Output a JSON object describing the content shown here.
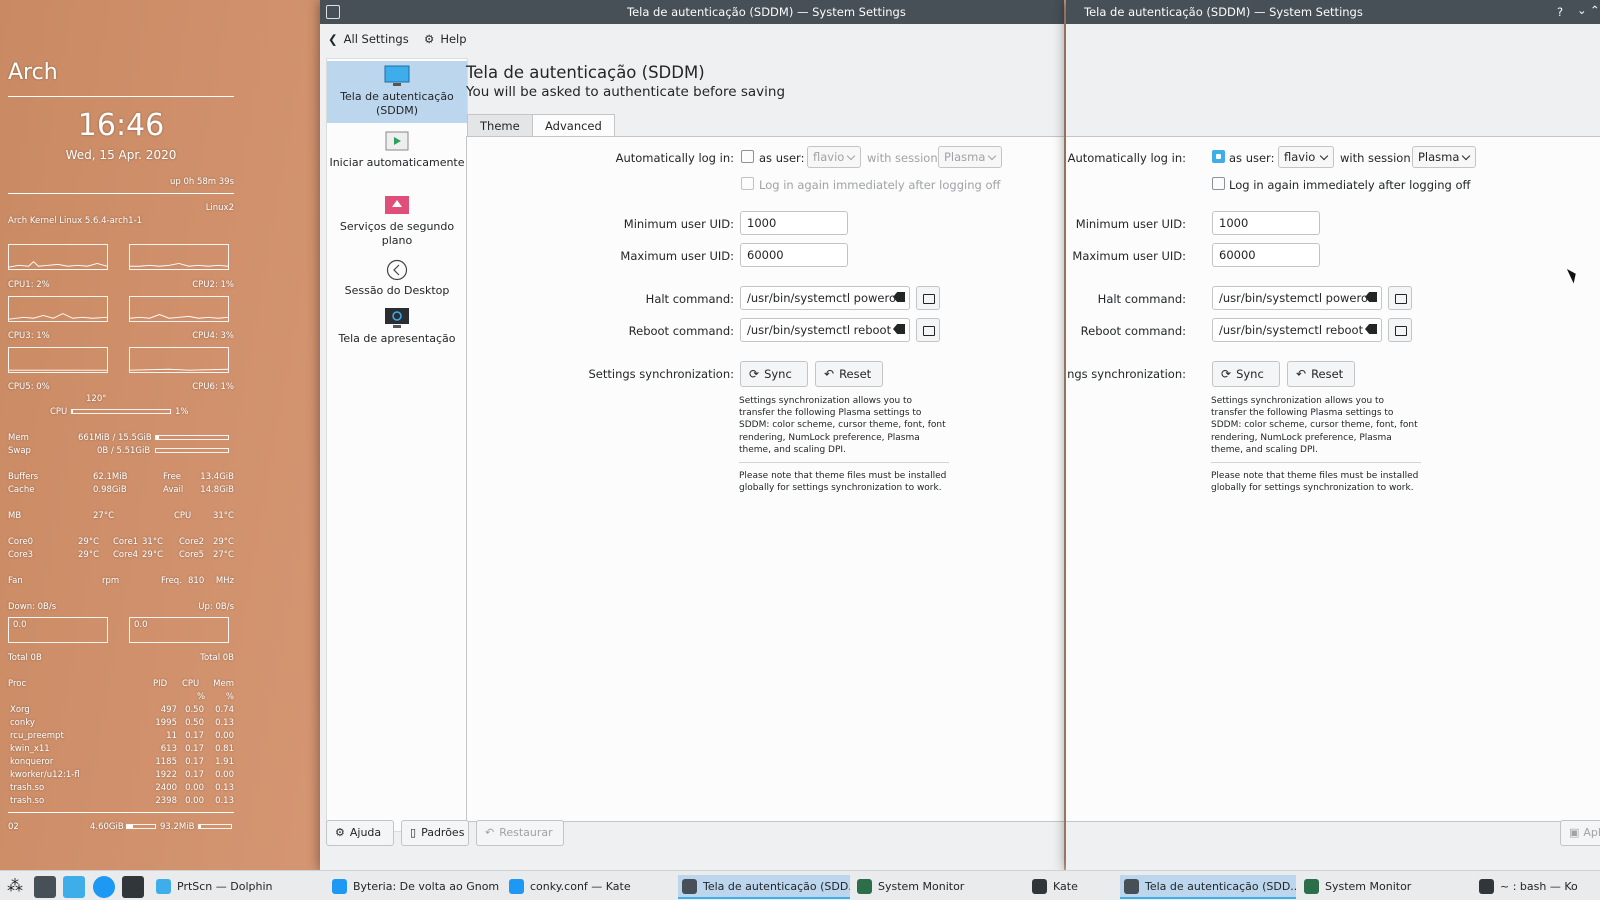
{
  "conky": {
    "hostname": "Arch",
    "time": "16:46",
    "date": "Wed, 15 Apr. 2020",
    "uptime": "up  0h 58m 39s",
    "os": "Linux2",
    "kernel": "Arch Kernel Linux 5.6.4-arch1-1",
    "cpus": [
      "CPU1: 2%",
      "CPU2: 1%",
      "CPU3: 1%",
      "CPU4: 3%",
      "CPU5: 0%",
      "CPU6: 1%"
    ],
    "cpu_temp": "120°",
    "cpu_label": "CPU",
    "cpu_pct": "1%",
    "cpu_fraction": 0.01,
    "mem_label": "Mem",
    "mem_val": "661MiB / 15.5GiB",
    "mem_fraction": 0.04,
    "swap_label": "Swap",
    "swap_val": "0B / 5.51GiB",
    "swap_fraction": 0.0,
    "buffers_label": "Buffers",
    "buffers": "62.1MiB",
    "free_label": "Free",
    "free": "13.4GiB",
    "cache_label": "Cache",
    "cache": "0.98GiB",
    "avail_label": "Avail",
    "avail": "14.8GiB",
    "mb_label": "MB",
    "mb_temp": "27°C",
    "cpu2_label": "CPU",
    "cpu2_temp": "31°C",
    "cores": [
      [
        "Core0",
        "29°C"
      ],
      [
        "Core1",
        "31°C"
      ],
      [
        "Core2",
        "29°C"
      ],
      [
        "Core3",
        "29°C"
      ],
      [
        "Core4",
        "29°C"
      ],
      [
        "Core5",
        "27°C"
      ]
    ],
    "fan_label": "Fan",
    "fan_unit": "rpm",
    "freq_label": "Freq.",
    "freq_val": "810",
    "freq_unit": "MHz",
    "down": "Down: 0B/s",
    "up": "Up: 0B/s",
    "down_graph": "0.0",
    "up_graph": "0.0",
    "total_down": "Total 0B",
    "total_up": "Total 0B",
    "proc_headers": [
      "Proc",
      "PID",
      "CPU",
      "Mem",
      "%",
      "%"
    ],
    "procs": [
      [
        "Xorg",
        "497",
        "0.50",
        "0.74"
      ],
      [
        "conky",
        "1995",
        "0.50",
        "0.13"
      ],
      [
        "rcu_preempt",
        "11",
        "0.17",
        "0.00"
      ],
      [
        "kwin_x11",
        "613",
        "0.17",
        "0.81"
      ],
      [
        "konqueror",
        "1185",
        "0.17",
        "1.91"
      ],
      [
        "kworker/u12:1-fl",
        "1922",
        "0.17",
        "0.00"
      ],
      [
        "trash.so",
        "2400",
        "0.00",
        "0.13"
      ],
      [
        "trash.so",
        "2398",
        "0.00",
        "0.13"
      ]
    ],
    "io_label": "02",
    "io_read": "4.60GiB",
    "io_write": "93.2MiB"
  },
  "window": {
    "title": "Tela de autenticação (SDDM) — System Settings",
    "all_settings": "All Settings",
    "help": "Help",
    "sidebar": [
      "Tela de autenticação (SDDM)",
      "Iniciar automaticamente",
      "Serviços de segundo plano",
      "Sessão do Desktop",
      "Tela de apresentação"
    ],
    "heading": "Tela de autenticação (SDDM)",
    "subheading": "You will be asked to authenticate before saving",
    "tabs": [
      "Theme",
      "Advanced"
    ],
    "autologin_label": "Automatically log in:",
    "as_user": "as user:",
    "user": "flavio",
    "with_session": "with session:",
    "session": "Plasma",
    "relogin": "Log in again immediately after logging off",
    "min_uid_label": "Minimum user UID:",
    "min_uid": "1000",
    "max_uid_label": "Maximum user UID:",
    "max_uid": "60000",
    "halt_label": "Halt command:",
    "halt": "/usr/bin/systemctl poweroff",
    "reboot_label": "Reboot command:",
    "reboot": "/usr/bin/systemctl reboot",
    "sync_label": "Settings synchronization:",
    "sync_btn": "Sync",
    "reset_btn": "Reset",
    "sync_note": "Settings synchronization allows you to\ntransfer the following Plasma settings to\nSDDM: color scheme, cursor theme, font, font\nrendering, NumLock preference, Plasma\ntheme, and scaling DPI.",
    "theme_note": "Please note that theme files must be installed\nglobally for settings synchronization to work.",
    "ajuda": "Ajuda",
    "padroes": "Padrões",
    "restaurar": "Restaurar",
    "aplicar": "Apli"
  },
  "taskbar": [
    {
      "label": "PrtScn — Dolphin",
      "color": "#3daee9"
    },
    {
      "label": "Byteria: De volta ao Gnom...",
      "color": "#1d99f3"
    },
    {
      "label": "conky.conf — Kate",
      "color": "#1d99f3"
    },
    {
      "label": "Tela de autenticação (SDD...",
      "color": "#475057"
    },
    {
      "label": "System Monitor",
      "color": "#2c6e49"
    },
    {
      "label": "Kate",
      "color": "#31363b"
    },
    {
      "label": "Tela de autenticação (SDD...",
      "color": "#475057"
    },
    {
      "label": "System Monitor",
      "color": "#2c6e49"
    },
    {
      "label": "~ : bash — Ko",
      "color": "#31363b"
    }
  ]
}
